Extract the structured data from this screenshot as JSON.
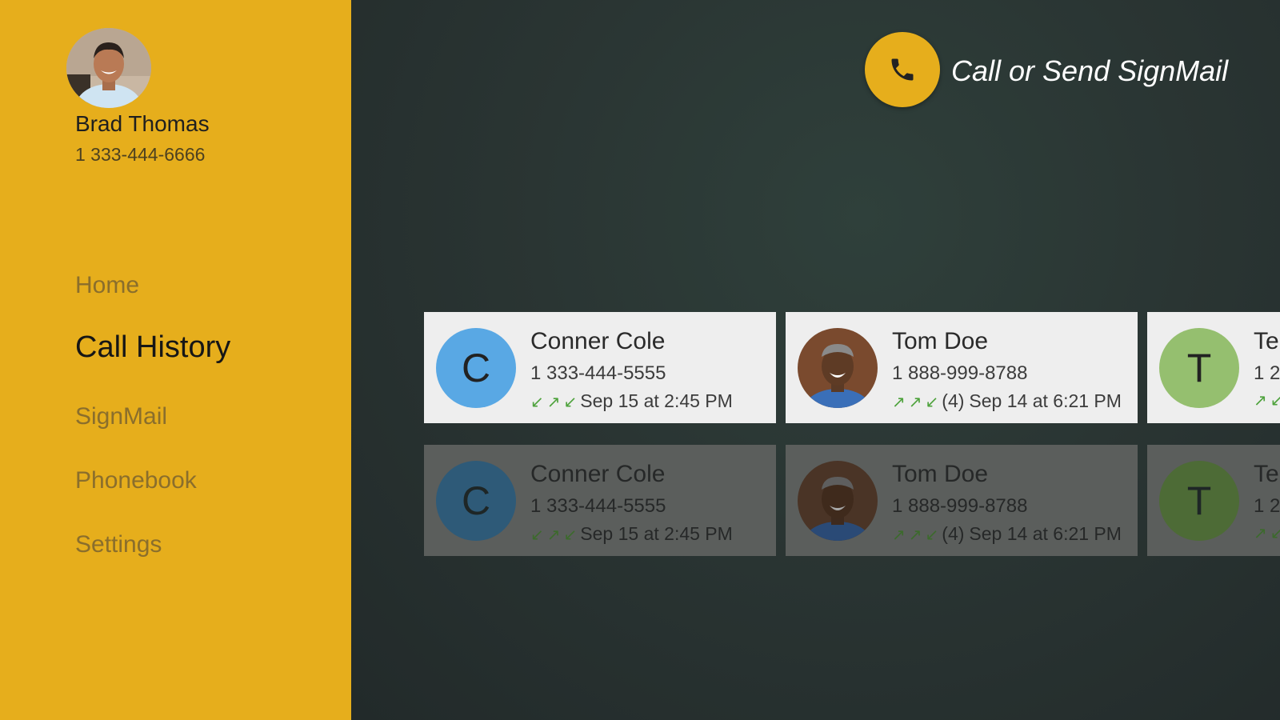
{
  "profile": {
    "name": "Brad Thomas",
    "phone": "1 333-444-6666"
  },
  "nav": {
    "items": [
      {
        "label": "Home",
        "active": false
      },
      {
        "label": "Call History",
        "active": true
      },
      {
        "label": "SignMail",
        "active": false
      },
      {
        "label": "Phonebook",
        "active": false
      },
      {
        "label": "Settings",
        "active": false
      }
    ]
  },
  "action": {
    "label": "Call or Send SignMail",
    "icon": "phone-icon"
  },
  "colors": {
    "accent": "#e6ae1c",
    "background": "#2c3634",
    "call_arrow": "#4ea23c",
    "avatar_blue": "#59a8e4",
    "avatar_green": "#95bf6f"
  },
  "call_history": {
    "rows": [
      {
        "cards": [
          {
            "initial": "C",
            "name": "Conner Cole",
            "phone": "1 333-444-5555",
            "arrows": [
              "incoming",
              "outgoing",
              "incoming"
            ],
            "count": "",
            "time": "Sep 15 at 2:45 PM",
            "avatar_color": "#59a8e4"
          },
          {
            "initial": "",
            "name": "Tom Doe",
            "phone": "1 888-999-8788",
            "arrows": [
              "outgoing",
              "outgoing",
              "incoming"
            ],
            "count": "(4)",
            "time": "Sep 14 at 6:21 PM",
            "avatar_color": "photo"
          },
          {
            "initial": "T",
            "name": "Te",
            "phone": "1 2",
            "arrows": [
              "outgoing",
              "incoming"
            ],
            "count": "",
            "time": "",
            "avatar_color": "#95bf6f"
          }
        ]
      },
      {
        "cards": [
          {
            "initial": "C",
            "name": "Conner Cole",
            "phone": "1 333-444-5555",
            "arrows": [
              "incoming",
              "outgoing",
              "incoming"
            ],
            "count": "",
            "time": "Sep 15 at 2:45 PM",
            "avatar_color": "#2e5a78"
          },
          {
            "initial": "",
            "name": "Tom Doe",
            "phone": "1 888-999-8788",
            "arrows": [
              "outgoing",
              "outgoing",
              "incoming"
            ],
            "count": "(4)",
            "time": "Sep 14 at 6:21 PM",
            "avatar_color": "photo"
          },
          {
            "initial": "T",
            "name": "Te",
            "phone": "1 2",
            "arrows": [
              "outgoing",
              "incoming"
            ],
            "count": "",
            "time": "",
            "avatar_color": "#4d6b36"
          }
        ]
      }
    ]
  }
}
